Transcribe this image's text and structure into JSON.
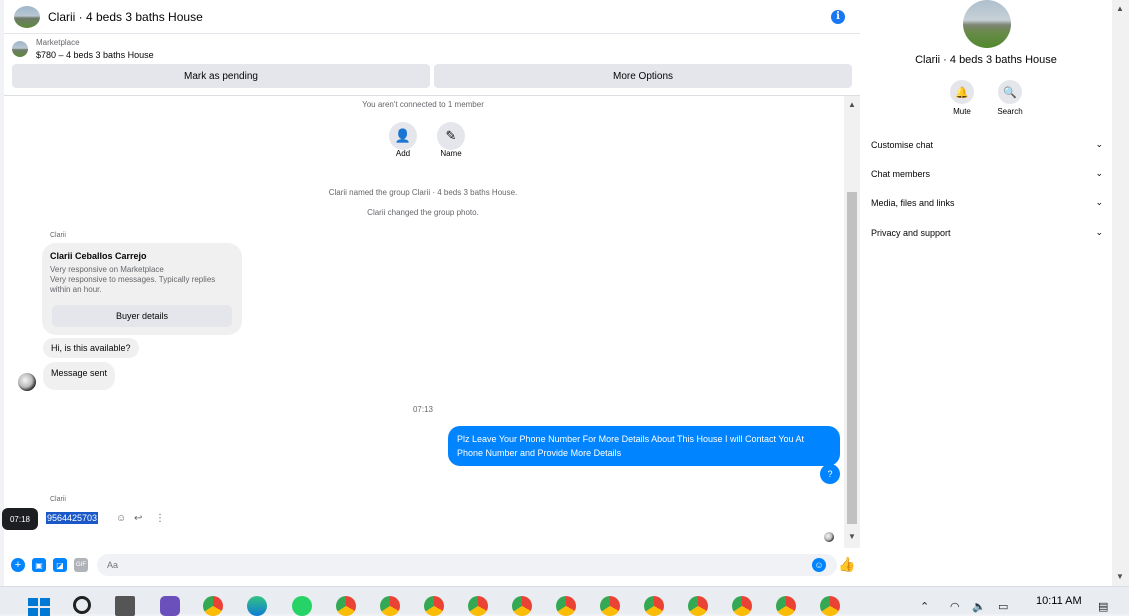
{
  "header": {
    "title": "Clarii · 4 beds 3 baths House"
  },
  "listing": {
    "kicker": "Marketplace",
    "price_title": "$780 – 4 beds 3 baths House"
  },
  "actions": {
    "mark_pending": "Mark as pending",
    "more_options": "More Options"
  },
  "messages": {
    "not_connected": "You aren't connected to 1 member",
    "add_label": "Add",
    "name_label": "Name",
    "named_group": "Clarii named the group Clarii · 4 beds 3 baths House.",
    "changed_photo": "Clarii changed the group photo.",
    "sender1": "Clarii",
    "card": {
      "name": "Clarii Ceballos Carrejo",
      "line1": "Very responsive on Marketplace",
      "line2": "Very responsive to messages. Typically replies",
      "line3": "within an hour.",
      "button": "Buyer details"
    },
    "msg1": "Hi, is this available?",
    "msg2": "Message sent",
    "timestamp": "07:13",
    "outgoing": "Plz Leave Your Phone Number For More Details About This House I will Contact You At Phone Number and Provide More Details",
    "outgoing_q": "?",
    "sender2": "Clarii",
    "phone": "9564425703",
    "tooltip_time": "07:18"
  },
  "composer": {
    "placeholder": "Aa"
  },
  "right_panel": {
    "title": "Clarii · 4 beds 3 baths House",
    "mute": "Mute",
    "search": "Search",
    "sections": [
      "Customise chat",
      "Chat members",
      "Media, files and links",
      "Privacy and support"
    ]
  },
  "taskbar": {
    "time": "10:11 AM"
  },
  "colors": {
    "accent": "#0084ff",
    "brand": "#1877f2"
  }
}
